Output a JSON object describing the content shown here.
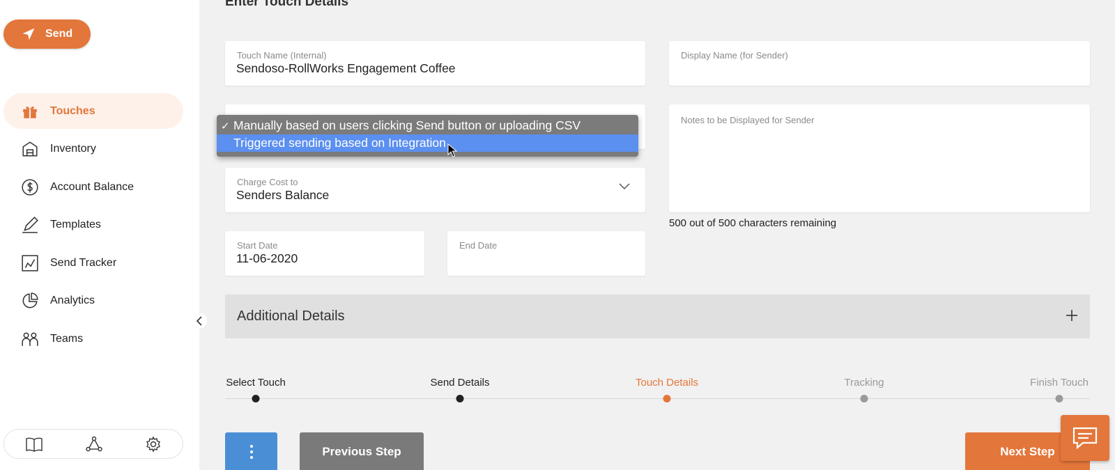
{
  "sidebar": {
    "send_label": "Send",
    "nav": [
      {
        "label": "Touches",
        "icon": "gift-icon",
        "active": true
      },
      {
        "label": "Inventory",
        "icon": "warehouse-icon",
        "active": false
      },
      {
        "label": "Account Balance",
        "icon": "dollar-circle-icon",
        "active": false
      },
      {
        "label": "Templates",
        "icon": "pen-icon",
        "active": false
      },
      {
        "label": "Send Tracker",
        "icon": "tracker-icon",
        "active": false
      },
      {
        "label": "Analytics",
        "icon": "pie-chart-icon",
        "active": false
      },
      {
        "label": "Teams",
        "icon": "team-icon",
        "active": false
      }
    ],
    "bottom_icons": [
      "book-icon",
      "network-icon",
      "gear-icon"
    ]
  },
  "main": {
    "title": "Enter Touch Details",
    "touch_name": {
      "label": "Touch Name (Internal)",
      "value": "Sendoso-RollWorks Engagement Coffee"
    },
    "display_name": {
      "label": "Display Name (for Sender)",
      "value": ""
    },
    "notes": {
      "label": "Notes to be Displayed for Sender",
      "value": ""
    },
    "chars_remaining": "500 out of 500 characters remaining",
    "charge_cost": {
      "label": "Charge Cost to",
      "value": "Senders Balance"
    },
    "start_date": {
      "label": "Start Date",
      "value": "11-06-2020"
    },
    "end_date": {
      "label": "End Date",
      "value": ""
    },
    "additional_details": "Additional Details"
  },
  "dropdown": {
    "options": [
      {
        "label": "Manually based on users clicking Send button or uploading CSV",
        "checked": true
      },
      {
        "label": "Triggered sending based on Integration",
        "highlighted": true
      }
    ],
    "check_mark": "✓"
  },
  "stepper": {
    "steps": [
      {
        "label": "Select Touch",
        "status": "done"
      },
      {
        "label": "Send Details",
        "status": "done"
      },
      {
        "label": "Touch Details",
        "status": "current"
      },
      {
        "label": "Tracking",
        "status": "pending"
      },
      {
        "label": "Finish Touch",
        "status": "pending"
      }
    ]
  },
  "buttons": {
    "previous": "Previous Step",
    "next": "Next Step"
  },
  "colors": {
    "accent": "#e3763a",
    "done": "#222222",
    "pending": "#9a9a9a"
  }
}
